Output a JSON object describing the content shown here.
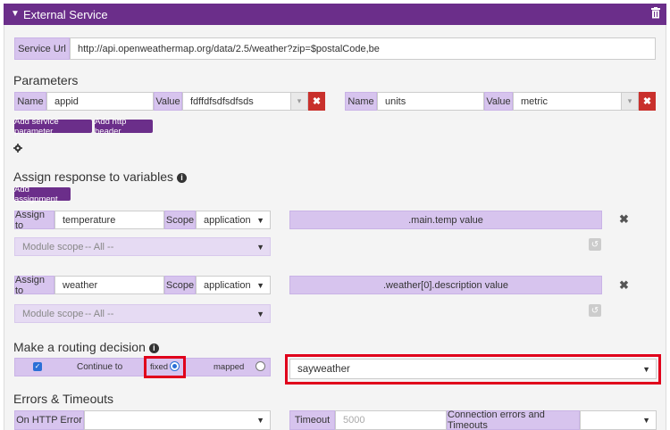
{
  "header": {
    "title": "External Service"
  },
  "service_url": {
    "label": "Service Url",
    "value": "http://api.openweathermap.org/data/2.5/weather?zip=$postalCode,be"
  },
  "parameters": {
    "heading": "Parameters",
    "items": [
      {
        "name_label": "Name",
        "name_value": "appid",
        "value_label": "Value",
        "value_value": "fdffdfsdfsdfsds"
      },
      {
        "name_label": "Name",
        "name_value": "units",
        "value_label": "Value",
        "value_value": "metric"
      }
    ],
    "add_service_parameter": "Add service parameter",
    "add_http_header": "Add http header"
  },
  "assign": {
    "heading": "Assign response to variables",
    "add_assignment": "Add assignment",
    "items": [
      {
        "assign_label": "Assign to",
        "assign_value": "temperature",
        "scope_label": "Scope",
        "scope_value": "application",
        "module_scope_label": "Module scope",
        "module_scope_value": "-- All --",
        "expression": ".main.temp value"
      },
      {
        "assign_label": "Assign to",
        "assign_value": "weather",
        "scope_label": "Scope",
        "scope_value": "application",
        "module_scope_label": "Module scope",
        "module_scope_value": "-- All --",
        "expression": ".weather[0].description value"
      }
    ]
  },
  "routing": {
    "heading": "Make a routing decision",
    "continue_label": "Continue to",
    "fixed_label": "fixed",
    "mapped_label": "mapped",
    "selected_target": "sayweather"
  },
  "errors": {
    "heading": "Errors & Timeouts",
    "on_http_error_label": "On HTTP Error",
    "on_http_error_value": "",
    "timeout_label": "Timeout",
    "timeout_placeholder": "5000",
    "connection_label": "Connection errors and Timeouts",
    "connection_value": ""
  },
  "colors": {
    "header": "#6b2e8a",
    "label_bg": "#d7c4ee",
    "delete": "#c9302c",
    "highlight": "#e0001b"
  },
  "icons": {
    "caret": "caret-down-icon",
    "trash": "trash-icon",
    "gear": "gear-icon",
    "info": "info-icon",
    "close": "close-icon",
    "reset": "reset-icon",
    "chevron": "chevron-down-icon"
  }
}
